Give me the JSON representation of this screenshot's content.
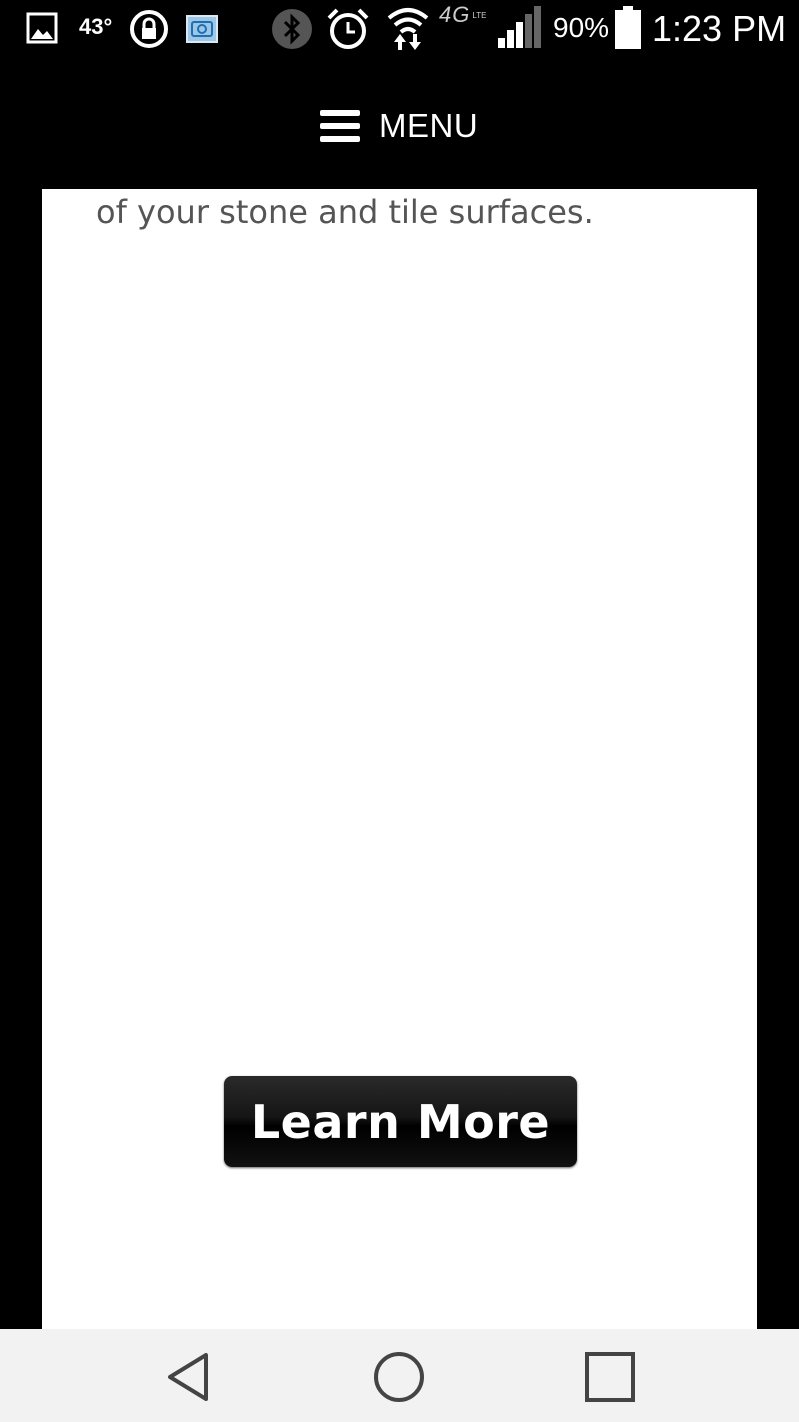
{
  "status_bar": {
    "temperature": "43°",
    "network": "4G",
    "network_sub": "LTE",
    "battery": "90%",
    "time": "1:23 PM",
    "icons": [
      "gallery-icon",
      "lock-icon",
      "camera-icon",
      "bluetooth-icon",
      "alarm-icon",
      "wifi-icon",
      "signal-icon",
      "battery-icon"
    ]
  },
  "header": {
    "menu_label": "MENU",
    "menu_icon": "hamburger-icon"
  },
  "main": {
    "body_text": "of your stone and tile surfaces.",
    "learn_more_label": "Learn More"
  },
  "nav_bar": {
    "icons": [
      "back-icon",
      "home-icon",
      "recents-icon"
    ]
  },
  "colors": {
    "background": "#000000",
    "content_bg": "#ffffff",
    "body_text": "#555555",
    "nav_bar": "#f2f2f2"
  }
}
